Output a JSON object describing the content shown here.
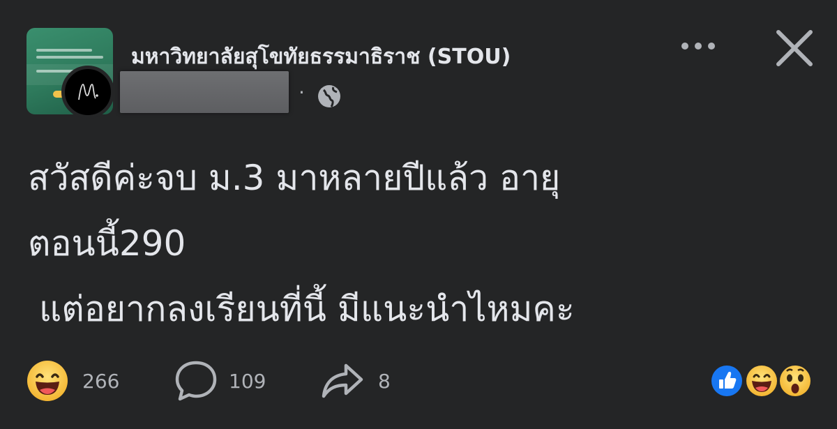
{
  "post": {
    "group_name": "มหาวิทยาลัยสุโขทัยธรรมาธิราช  (STOU)",
    "meta_separator": "·",
    "privacy_icon": "globe-icon",
    "text_lines": [
      "สวัสดีค่ะจบ ม.3 มาหลายปีแล้ว อายุ",
      "ตอนนี้290",
      "แต่อยากลงเรียนที่นี้ มีแนะนำไหมคะ"
    ]
  },
  "header": {
    "more_icon": "more-dots-icon",
    "close_icon": "close-icon"
  },
  "actions": {
    "reactions_count": "266",
    "comments_count": "109",
    "shares_count": "8",
    "reaction_icon": "laughing-face-icon",
    "comment_icon": "comment-bubble-icon",
    "share_icon": "share-arrow-icon"
  },
  "reactions_summary": [
    "like-icon",
    "haha-icon",
    "wow-icon"
  ],
  "colors": {
    "background": "#242526",
    "text_primary": "#e4e6eb",
    "text_secondary": "#b0b3b8",
    "like_blue": "#1877f2",
    "emoji_yellow": "#f7c544"
  }
}
